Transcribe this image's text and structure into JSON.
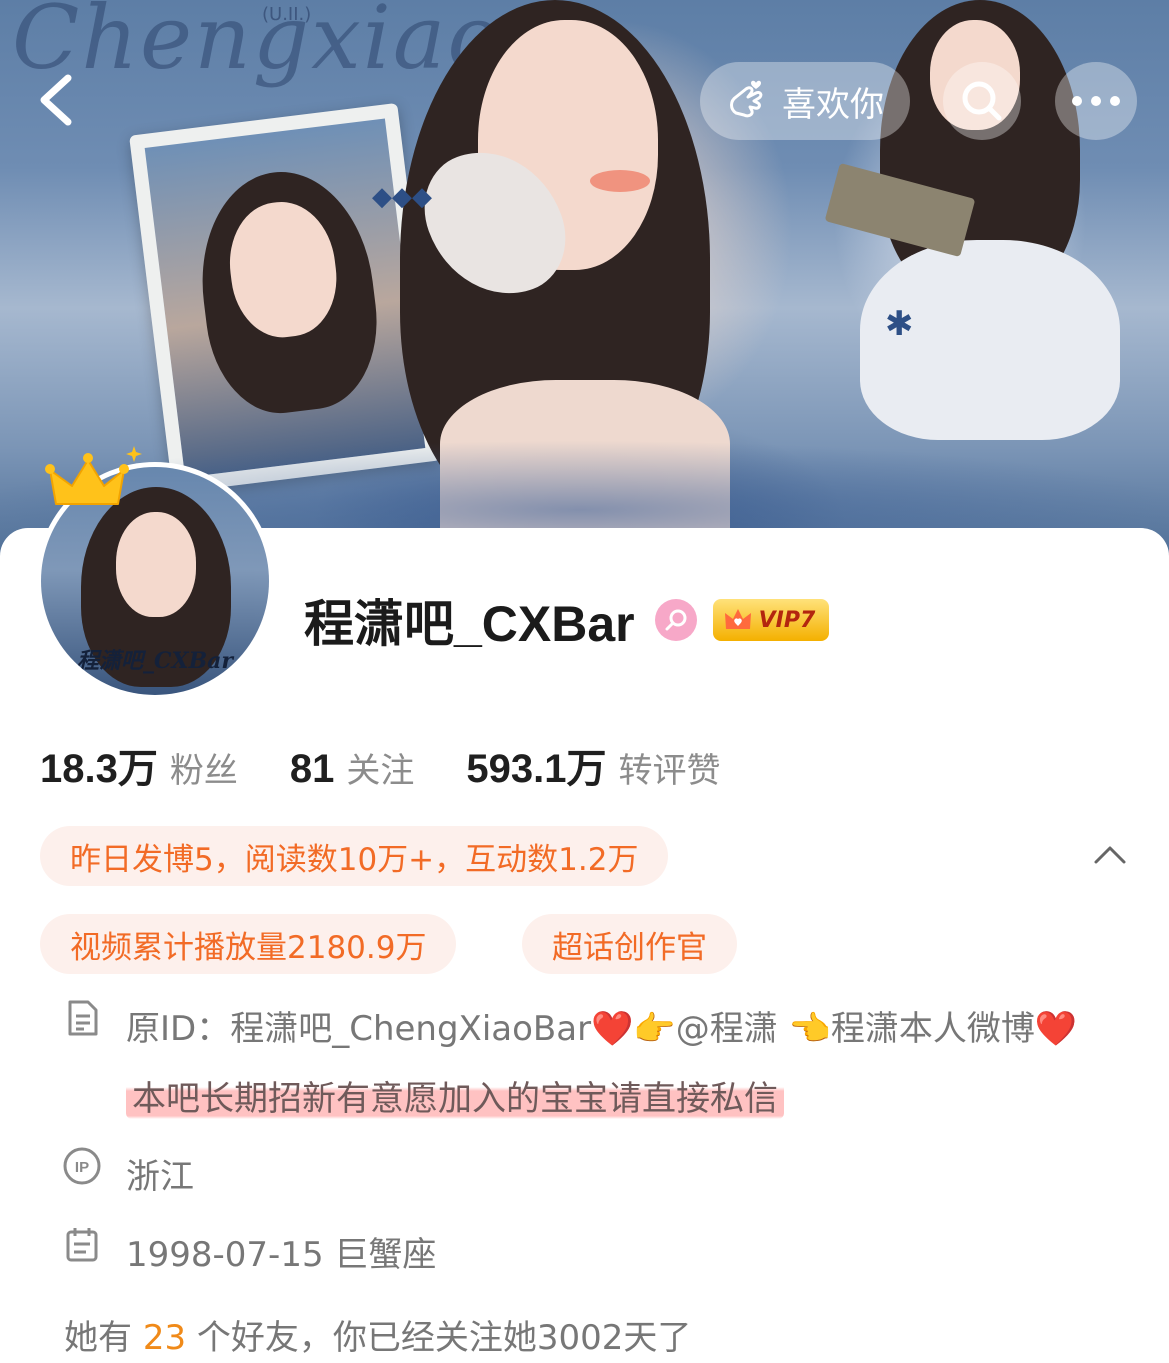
{
  "cover": {
    "script_text": "Chengxiao",
    "tag_text": "(U.II.)"
  },
  "nav": {
    "like_label": "喜欢你"
  },
  "profile": {
    "name": "程潇吧_CXBar",
    "vip_label": "VIP7",
    "avatar_text": "程潇吧_CXBar"
  },
  "stats": [
    {
      "value": "18.3万",
      "label": "粉丝"
    },
    {
      "value": "81",
      "label": "关注"
    },
    {
      "value": "593.1万",
      "label": "转评赞"
    }
  ],
  "chips": {
    "yesterday": "昨日发博5，阅读数10万+，互动数1.2万",
    "video": "视频累计播放量2180.9万",
    "title": "超话创作官"
  },
  "bio": {
    "part1": "原ID：程潇吧_ChengXiaoBar",
    "heart": "❤️",
    "part2": "👉@程潇 👈程潇本人微博",
    "heart2": "❤️",
    "highlight": "本吧长期招新有意愿加入的宝宝请直接私信"
  },
  "location": "浙江",
  "birthday": "1998-07-15 巨蟹座",
  "friends": {
    "prefix": "她有",
    "count": "23",
    "suffix": "个好友，你已经关注她3002天了"
  },
  "colors": {
    "accent_orange": "#f26b26",
    "chip_bg": "#fdf0ec",
    "vip_gold": "#f4b000",
    "gender_pink": "#f7a8c8",
    "highlight_red": "#ff7878"
  }
}
